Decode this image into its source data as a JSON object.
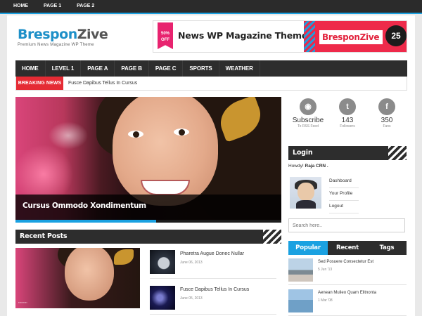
{
  "top_nav": [
    "HOME",
    "PAGE 1",
    "PAGE 2"
  ],
  "logo": {
    "name_part1": "Brespon",
    "name_part2": "Zive",
    "tagline": "Premium News Magazine WP Theme"
  },
  "banner": {
    "badge": "50% OFF",
    "text": "News WP Magazine Theme",
    "brand": "BresponZive",
    "number": "25"
  },
  "main_nav": [
    "HOME",
    "LEVEL 1",
    "PAGE A",
    "PAGE B",
    "PAGE C",
    "SPORTS",
    "WEATHER"
  ],
  "breaking": {
    "label": "BREAKING NEWS",
    "headline": "Fusce Dapibus Tellus In Cursus"
  },
  "slider": {
    "caption": "Cursus Ommodo Xondimentum",
    "progress": 0.53
  },
  "recent_posts": {
    "heading": "Recent Posts",
    "items": [
      {
        "title": "Pharetra Augue Donec Nullar",
        "date": "June 06, 2013"
      },
      {
        "title": "Fusce Dapibus Tellus In Cursus",
        "date": "June 05, 2013"
      }
    ]
  },
  "social": [
    {
      "icon": "rss-icon",
      "glyph": "◉",
      "big": "Subscribe",
      "small": "To RSS Feed"
    },
    {
      "icon": "twitter-icon",
      "glyph": "t",
      "big": "143",
      "small": "Followers"
    },
    {
      "icon": "facebook-icon",
      "glyph": "f",
      "big": "350",
      "small": "Fans"
    }
  ],
  "login": {
    "heading": "Login",
    "howdy_prefix": "Howdy!",
    "user": "Raja CRN .",
    "links": [
      "Dashboard",
      "Your Profile",
      "Logout"
    ]
  },
  "search": {
    "placeholder": "Search here.."
  },
  "tabs": [
    "Popular",
    "Recent",
    "Tags"
  ],
  "tab_items": [
    {
      "title": "Sed Posuere Consectetur Est",
      "date": "5 Jun '13"
    },
    {
      "title": "Aenean Mulieo Quam Elitnonta",
      "date": "1 Mar '08"
    }
  ],
  "colors": {
    "accent": "#1aa1e1",
    "breaking": "#e52b34",
    "dark": "#2d2d2d"
  }
}
